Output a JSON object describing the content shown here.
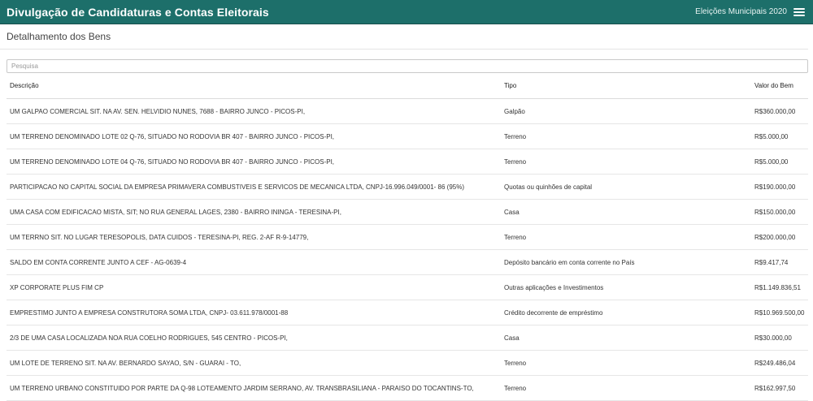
{
  "header": {
    "app_title": "Divulgação de Candidaturas e Contas Eleitorais",
    "election": "Eleições Municipais 2020"
  },
  "page": {
    "title": "Detalhamento dos Bens"
  },
  "search": {
    "placeholder": "Pesquisa",
    "value": ""
  },
  "table": {
    "columns": [
      "Descrição",
      "Tipo",
      "Valor do Bem"
    ],
    "rows": [
      {
        "descricao": "UM GALPAO COMERCIAL SIT. NA AV. SEN. HELVIDIO NUNES, 7688 - BAIRRO JUNCO - PICOS-PI,",
        "tipo": "Galpão",
        "valor": "R$360.000,00"
      },
      {
        "descricao": "UM TERRENO DENOMINADO LOTE 02 Q-76, SITUADO NO RODOVIA BR 407 - BAIRRO JUNCO - PICOS-PI,",
        "tipo": "Terreno",
        "valor": "R$5.000,00"
      },
      {
        "descricao": "UM TERRENO DENOMINADO LOTE 04 Q-76, SITUADO NO RODOVIA BR 407 - BAIRRO JUNCO - PICOS-PI,",
        "tipo": "Terreno",
        "valor": "R$5.000,00"
      },
      {
        "descricao": "PARTICIPACAO NO CAPITAL SOCIAL DA EMPRESA PRIMAVERA COMBUSTIVEIS E SERVICOS DE MECANICA LTDA, CNPJ-16.996.049/0001- 86 (95%)",
        "tipo": "Quotas ou quinhões de capital",
        "valor": "R$190.000,00"
      },
      {
        "descricao": "UMA CASA COM EDIFICACAO MISTA, SIT; NO RUA GENERAL LAGES, 2380 - BAIRRO ININGA - TERESINA-PI,",
        "tipo": "Casa",
        "valor": "R$150.000,00"
      },
      {
        "descricao": "UM TERRNO SIT. NO LUGAR TERESOPOLIS, DATA CUIDOS - TERESINA-PI, REG. 2-AF R-9-14779,",
        "tipo": "Terreno",
        "valor": "R$200.000,00"
      },
      {
        "descricao": "SALDO EM CONTA CORRENTE JUNTO A CEF - AG-0639-4",
        "tipo": "Depósito bancário em conta corrente no País",
        "valor": "R$9.417,74"
      },
      {
        "descricao": "XP CORPORATE PLUS FIM CP",
        "tipo": "Outras aplicações e Investimentos",
        "valor": "R$1.149.836,51"
      },
      {
        "descricao": "EMPRESTIMO JUNTO A EMPRESA CONSTRUTORA SOMA LTDA, CNPJ- 03.611.978/0001-88",
        "tipo": "Crédito decorrente de empréstimo",
        "valor": "R$10.969.500,00"
      },
      {
        "descricao": "2/3 DE UMA CASA LOCALIZADA NOA RUA COELHO RODRIGUES, 545 CENTRO - PICOS-PI,",
        "tipo": "Casa",
        "valor": "R$30.000,00"
      },
      {
        "descricao": "UM LOTE DE TERRENO SIT. NA AV. BERNARDO SAYAO, S/N - GUARAI - TO,",
        "tipo": "Terreno",
        "valor": "R$249.486,04"
      },
      {
        "descricao": "UM TERRENO URBANO CONSTITUIDO POR PARTE DA Q-98 LOTEAMENTO JARDIM SERRANO, AV. TRANSBRASILIANA - PARAISO DO TOCANTINS-TO,",
        "tipo": "Terreno",
        "valor": "R$162.997,50"
      }
    ]
  }
}
